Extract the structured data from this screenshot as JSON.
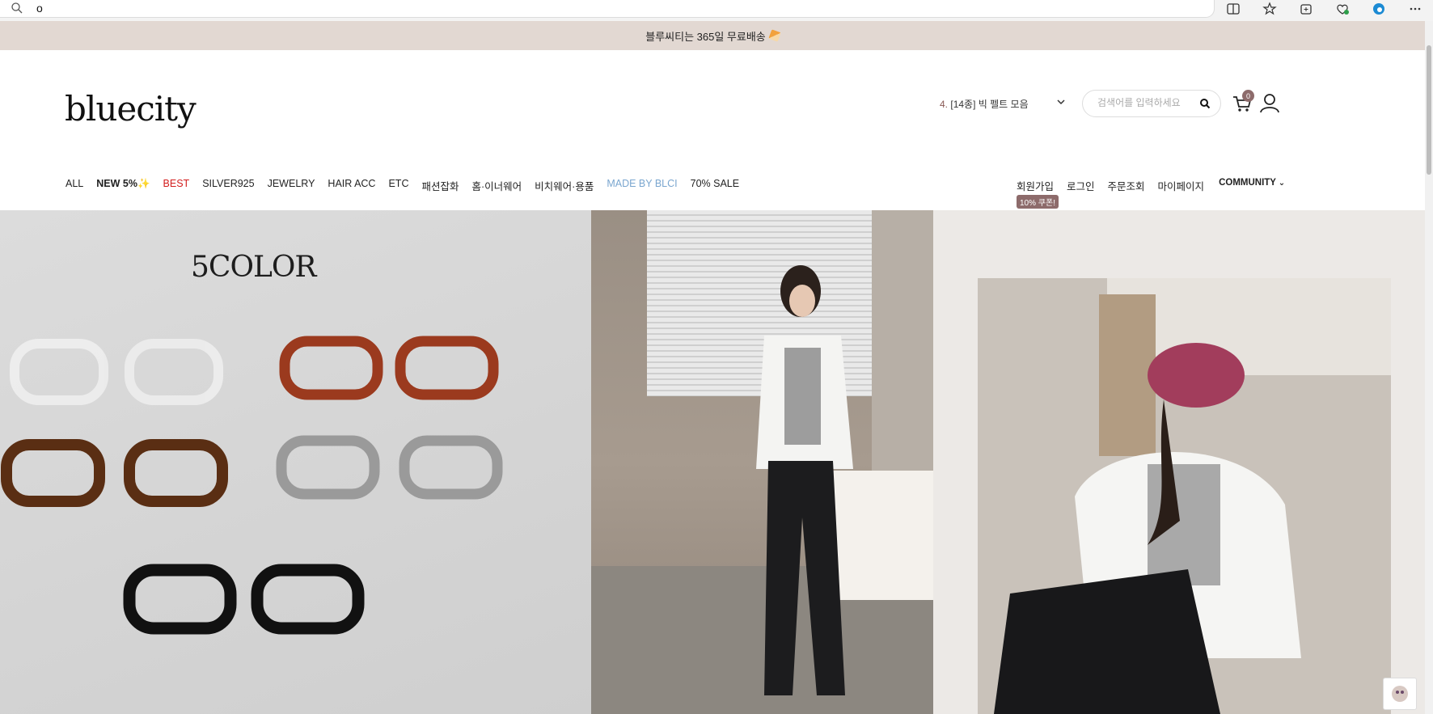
{
  "browser": {
    "url": "o",
    "icons": [
      "split-screen-icon",
      "favorites-star-icon",
      "collections-icon",
      "browser-essentials-icon",
      "edge-icon",
      "more-icon"
    ]
  },
  "announcement": {
    "text": "블루씨티는 365일 무료배송"
  },
  "header": {
    "logo": "bluecity",
    "promo_num": "4.",
    "promo_text": "[14종] 빅 펠트 모음",
    "search_placeholder": "검색어를 입력하세요",
    "cart_count": "0"
  },
  "nav": {
    "items": [
      "ALL",
      "NEW 5%✨",
      "BEST",
      "SILVER925",
      "JEWELRY",
      "HAIR ACC",
      "ETC",
      "패션잡화",
      "홈·이너웨어",
      "비치웨어·용품",
      "MADE BY BLCI",
      "70% SALE"
    ],
    "highlight_colors": {
      "best": "#d21d1d",
      "made_by": "#7aa6cf"
    }
  },
  "util": {
    "items": [
      "회원가입",
      "로그인",
      "주문조회",
      "마이페이지",
      "COMMUNITY"
    ],
    "coupon": "10% 쿠폰!"
  },
  "hero": {
    "left_title": "5COLOR"
  },
  "colors": {
    "announce_bg": "#e2d8d2",
    "badge": "#8d6b6b"
  }
}
